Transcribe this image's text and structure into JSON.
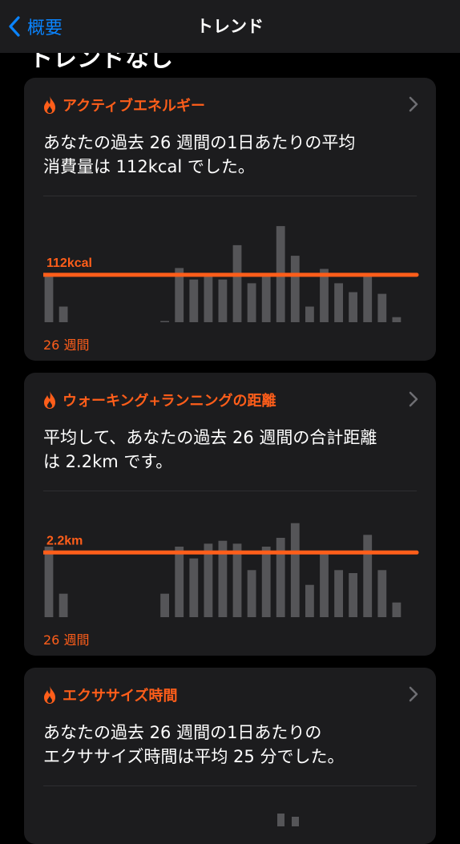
{
  "nav": {
    "back_label": "概要",
    "title": "トレンド"
  },
  "section_heading": "トレンドなし",
  "colors": {
    "accent": "#ff5e1a",
    "bar": "#555558",
    "link": "#0a84ff",
    "card_bg": "#1c1c1e"
  },
  "cards": [
    {
      "title": "アクティブエネルギー",
      "icon": "flame-icon",
      "desc_line1": "あなたの過去 26 週間の1日あたりの平均",
      "desc_line2": "消費量は 112kcal でした。",
      "average_label": "112kcal",
      "footer": "26 週間"
    },
    {
      "title": "ウォーキング+ランニングの距離",
      "icon": "flame-icon",
      "desc_line1": "平均して、あなたの過去 26 週間の合計距離",
      "desc_line2": "は 2.2km です。",
      "average_label": "2.2km",
      "footer": "26 週間"
    },
    {
      "title": "エクササイズ時間",
      "icon": "flame-icon",
      "desc_line1": "あなたの過去 26 週間の1日あたりの",
      "desc_line2": "エクササイズ時間は平均 25 分でした。"
    }
  ],
  "chart_data": [
    {
      "type": "bar",
      "x": [
        1,
        2,
        3,
        4,
        5,
        6,
        7,
        8,
        9,
        10,
        11,
        12,
        13,
        14,
        15,
        16,
        17,
        18,
        19,
        20,
        21,
        22,
        23,
        24,
        25,
        26
      ],
      "values": [
        112,
        37,
        0,
        0,
        0,
        0,
        0,
        0,
        2,
        128,
        101,
        108,
        101,
        182,
        92,
        108,
        227,
        157,
        37,
        126,
        92,
        71,
        110,
        67,
        12,
        0
      ],
      "average": 112,
      "ylim": [
        0,
        250
      ]
    },
    {
      "type": "bar",
      "x": [
        1,
        2,
        3,
        4,
        5,
        6,
        7,
        8,
        9,
        10,
        11,
        12,
        13,
        14,
        15,
        16,
        17,
        18,
        19,
        20,
        21,
        22,
        23,
        24,
        25,
        26
      ],
      "values": [
        2.4,
        0.8,
        0,
        0,
        0,
        0,
        0,
        0,
        0.8,
        2.4,
        2.0,
        2.5,
        2.6,
        2.5,
        1.6,
        2.4,
        2.7,
        3.2,
        1.1,
        2.2,
        1.6,
        1.5,
        2.8,
        1.6,
        0.5,
        0
      ],
      "average": 2.2,
      "ylim": [
        0,
        3.6
      ]
    }
  ]
}
